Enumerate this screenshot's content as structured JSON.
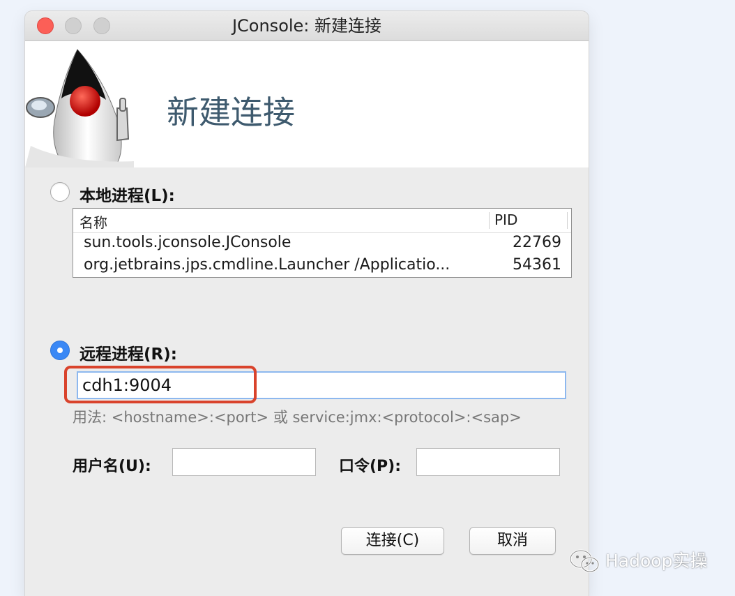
{
  "window": {
    "title": "JConsole: 新建连接"
  },
  "banner": {
    "title": "新建连接",
    "logo": "duke-mascot"
  },
  "local": {
    "label": "本地进程(L):",
    "selected": false,
    "columns": {
      "name": "名称",
      "pid": "PID"
    },
    "rows": [
      {
        "name": "sun.tools.jconsole.JConsole",
        "pid": "22769"
      },
      {
        "name": "org.jetbrains.jps.cmdline.Launcher /Applicatio...",
        "pid": "54361"
      }
    ]
  },
  "remote": {
    "label": "远程进程(R):",
    "selected": true,
    "value": "cdh1:9004",
    "usage": "用法: <hostname>:<port> 或 service:jmx:<protocol>:<sap>"
  },
  "credentials": {
    "username_label": "用户名(U):",
    "username_value": "",
    "password_label": "口令(P):",
    "password_value": ""
  },
  "buttons": {
    "connect": "连接(C)",
    "cancel": "取消"
  },
  "watermark": {
    "text": "Hadoop实操",
    "icon": "wechat-icon"
  },
  "colors": {
    "accent": "#3a88f5",
    "highlight": "#d9432c",
    "banner_title": "#3e5a6e"
  }
}
